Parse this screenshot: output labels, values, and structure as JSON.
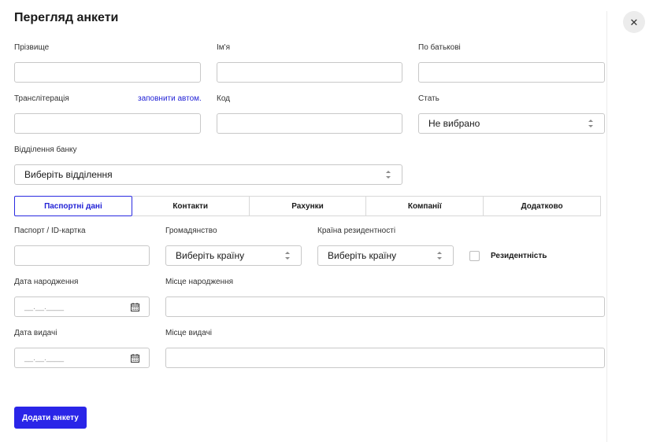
{
  "title": "Перегляд анкети",
  "fields": {
    "surname": {
      "label": "Прізвище",
      "value": ""
    },
    "name": {
      "label": "Ім'я",
      "value": ""
    },
    "patronymic": {
      "label": "По батькові",
      "value": ""
    },
    "transliteration": {
      "label": "Транслітерація",
      "autofill_link": "заповнити автом.",
      "value": ""
    },
    "code": {
      "label": "Код",
      "value": ""
    },
    "gender": {
      "label": "Стать",
      "value": "Не вибрано"
    },
    "branch": {
      "label": "Відділення банку",
      "value": "Виберіть відділення"
    }
  },
  "tabs": [
    {
      "label": "Паспортні дані",
      "active": true
    },
    {
      "label": "Контакти",
      "active": false
    },
    {
      "label": "Рахунки",
      "active": false
    },
    {
      "label": "Компанії",
      "active": false
    },
    {
      "label": "Додатково",
      "active": false
    }
  ],
  "passport": {
    "id_label": "Паспорт / ID-картка",
    "citizenship_label": "Громадянство",
    "citizenship_value": "Виберіть країну",
    "residence_country_label": "Країна резидентності",
    "residence_country_value": "Виберіть країну",
    "residency_label": "Резидентність",
    "birth_date_label": "Дата народження",
    "birth_date_placeholder": "__.__.____",
    "birth_place_label": "Місце народження",
    "issue_date_label": "Дата видачі",
    "issue_date_placeholder": "__.__.____",
    "issue_place_label": "Місце видачі"
  },
  "actions": {
    "submit_label": "Додати анкету",
    "close_glyph": "✕"
  },
  "colors": {
    "accent": "#2a25e8",
    "link": "#2323d6",
    "border": "#c8c8c8"
  }
}
